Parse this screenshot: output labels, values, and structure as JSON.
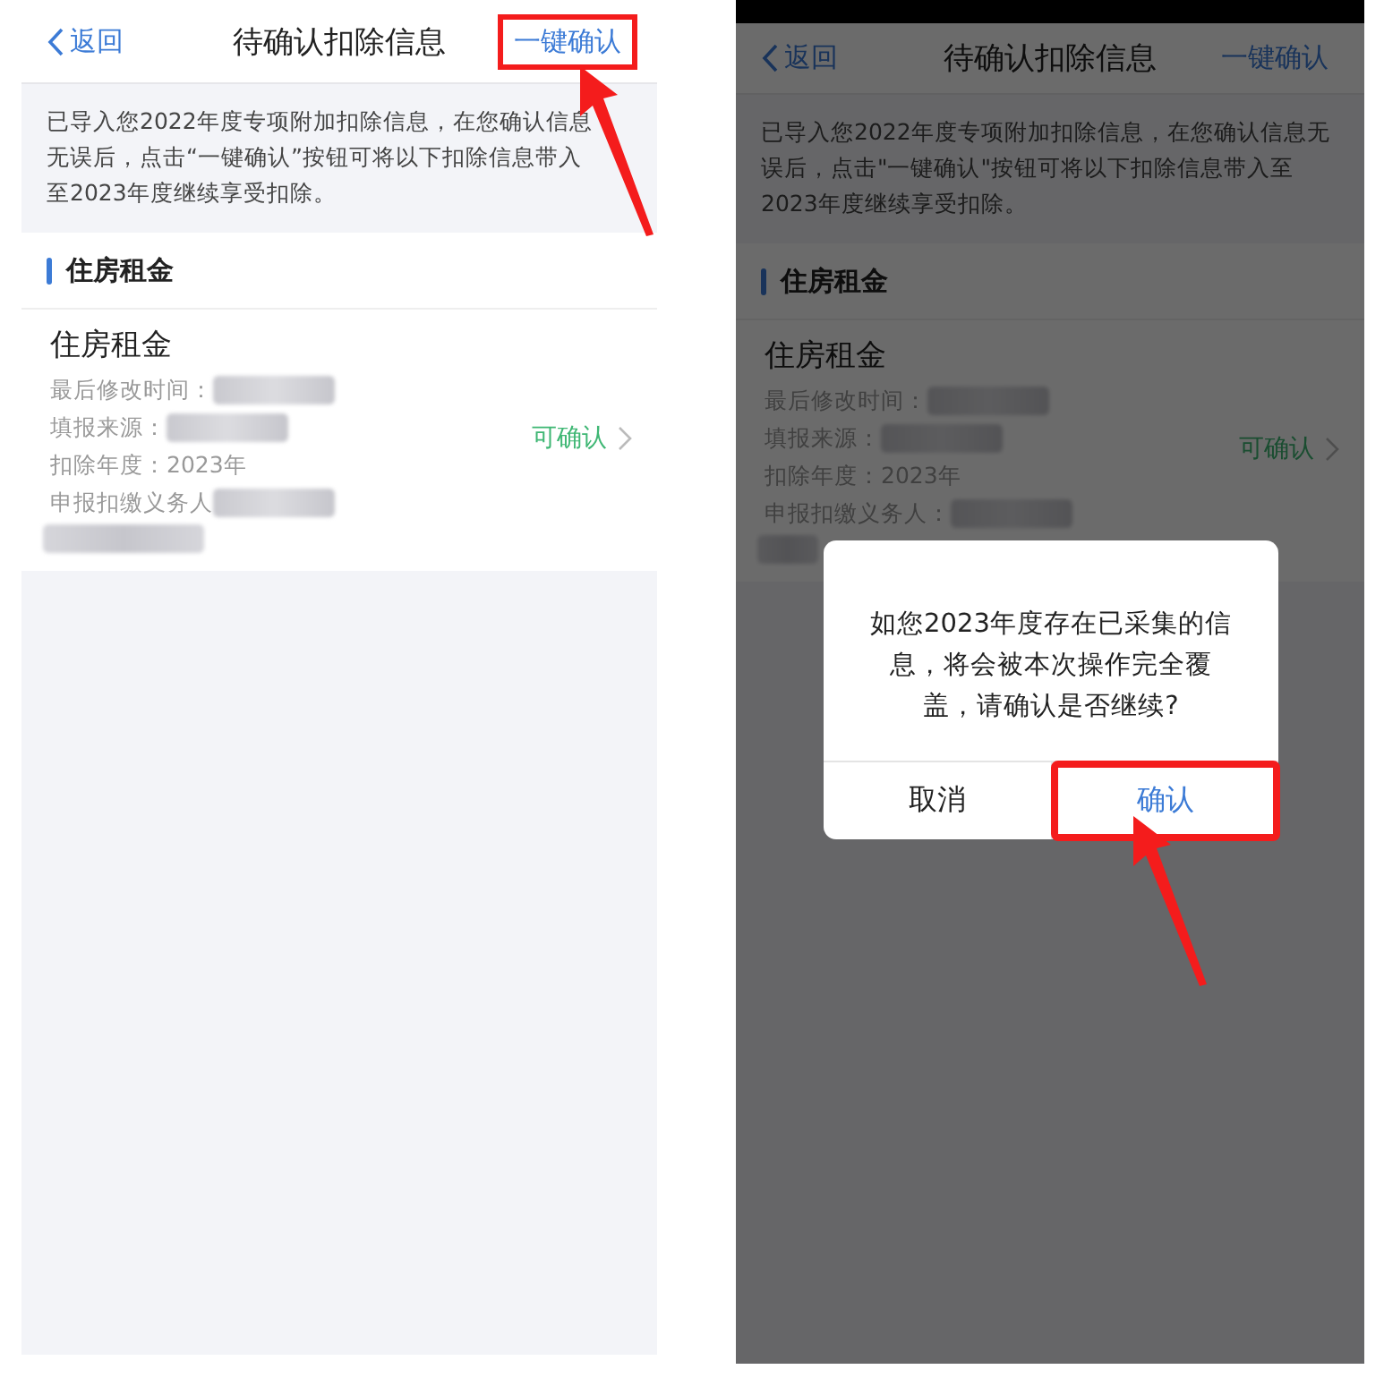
{
  "screens": [
    {
      "nav": {
        "back": "返回",
        "title": "待确认扣除信息",
        "action": {
          "label": "一键确认",
          "highlighted": true
        }
      },
      "notice": "已导入您2022年度专项附加扣除信息，在您确认信息无误后，点击“一键确认”按钮可将以下扣除信息带入至2023年度继续享受扣除。",
      "section": {
        "title": "住房租金",
        "items": [
          {
            "title": "住房租金",
            "status": "可确认",
            "fields": [
              {
                "kind": "text",
                "label": "最后修改时间：",
                "redacted": true
              },
              {
                "kind": "text",
                "label": "填报来源：",
                "redacted": true
              },
              {
                "kind": "text",
                "label": "扣除年度：2023年",
                "redacted": false
              },
              {
                "kind": "text",
                "label": "申报扣缴义务人",
                "redacted": true
              },
              {
                "kind": "redacted_line"
              }
            ]
          }
        ]
      }
    },
    {
      "status_bar": true,
      "dimmed": true,
      "nav": {
        "back": "返回",
        "title": "待确认扣除信息",
        "action": {
          "label": "一键确认",
          "highlighted": false
        }
      },
      "notice": "已导入您2022年度专项附加扣除信息，在您确认信息无误后，点击\"一键确认\"按钮可将以下扣除信息带入至2023年度继续享受扣除。",
      "section": {
        "title": "住房租金",
        "items": [
          {
            "title": "住房租金",
            "status": "可确认",
            "fields": [
              {
                "kind": "text",
                "label": "最后修改时间：",
                "redacted": true
              },
              {
                "kind": "text",
                "label": "填报来源：",
                "redacted": true
              },
              {
                "kind": "text",
                "label": "扣除年度：2023年",
                "redacted": false
              },
              {
                "kind": "text",
                "label": "申报扣缴义务人：",
                "redacted": true
              },
              {
                "kind": "redacted_line"
              }
            ]
          }
        ]
      },
      "dialog": {
        "message": "如您2023年度存在已采集的信息，将会被本次操作完全覆盖，请确认是否继续?",
        "buttons": [
          {
            "kind": "cancel",
            "label": "取消",
            "highlighted": false
          },
          {
            "kind": "confirm",
            "label": "确认",
            "highlighted": true
          }
        ]
      }
    }
  ]
}
